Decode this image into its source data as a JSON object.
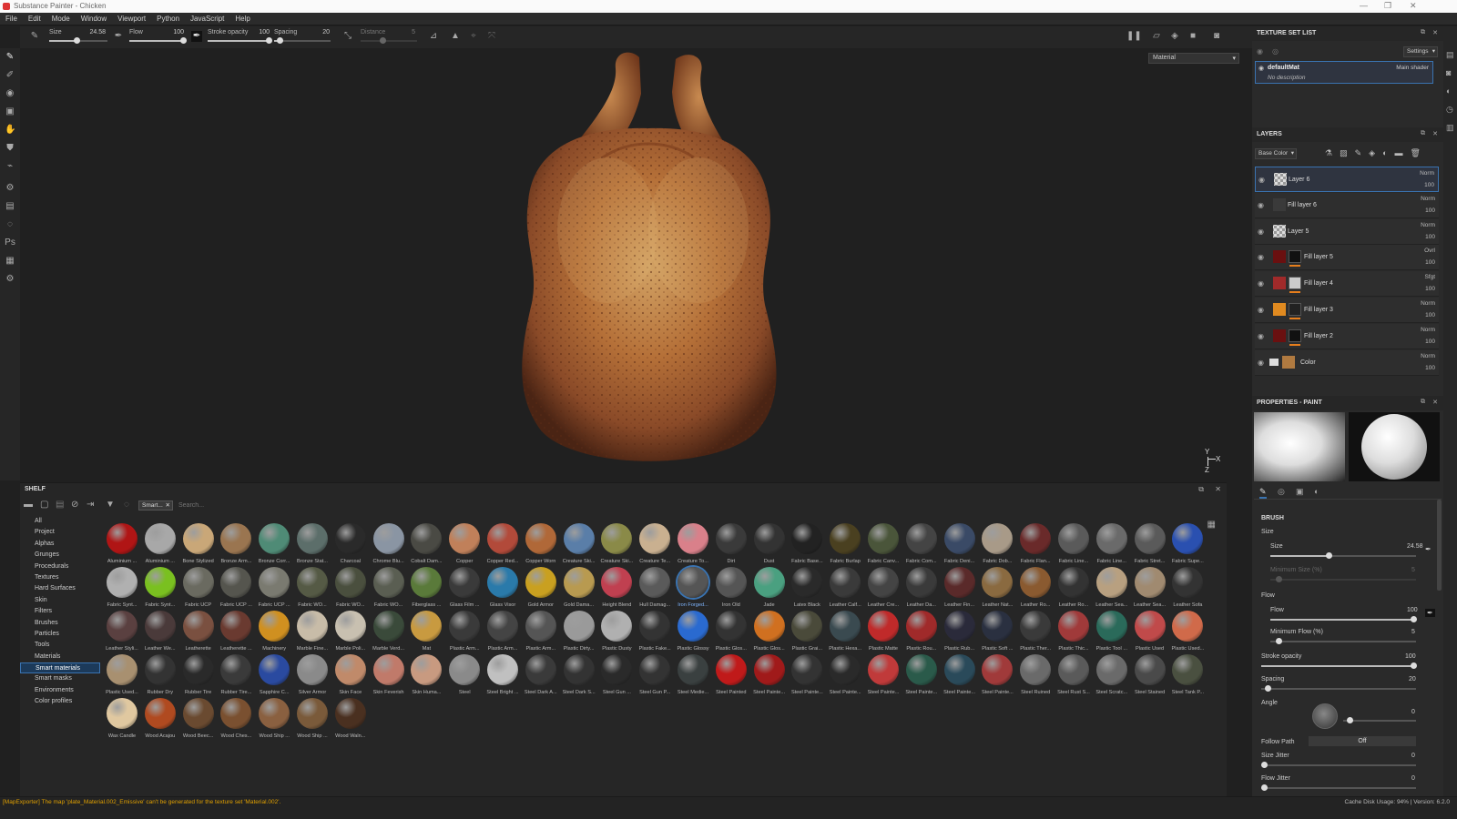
{
  "window": {
    "title": "Substance Painter - Chicken"
  },
  "menu": [
    "File",
    "Edit",
    "Mode",
    "Window",
    "Viewport",
    "Python",
    "JavaScript",
    "Help"
  ],
  "toolbar": {
    "size_label": "Size",
    "size_value": "24.58",
    "flow_label": "Flow",
    "flow_value": "100",
    "stroke_opacity_label": "Stroke opacity",
    "stroke_opacity_value": "100",
    "spacing_label": "Spacing",
    "spacing_value": "20",
    "distance_label": "Distance",
    "distance_value": "5"
  },
  "viewport": {
    "mode_select": "Material",
    "axis_y": "Y",
    "axis_z": "Z",
    "axis_x": "X"
  },
  "shelf": {
    "title": "SHELF",
    "filter_chip": "Smart...",
    "search_placeholder": "Search...",
    "categories": [
      "All",
      "Project",
      "Alphas",
      "Grunges",
      "Procedurals",
      "Textures",
      "Hard Surfaces",
      "Skin",
      "Filters",
      "Brushes",
      "Particles",
      "Tools",
      "Materials",
      "Smart materials",
      "Smart masks",
      "Environments",
      "Color profiles"
    ],
    "selected_category": "Smart materials",
    "materials": [
      {
        "n": "Aluminium ...",
        "c": "#b01515"
      },
      {
        "n": "Aluminium ...",
        "c": "#a8a8a8"
      },
      {
        "n": "Bone Stylized",
        "c": "#c9a778"
      },
      {
        "n": "Bronze Arm...",
        "c": "#9a7550"
      },
      {
        "n": "Bronze Corr...",
        "c": "#4f8b76"
      },
      {
        "n": "Bronze Stat...",
        "c": "#5c6e6a"
      },
      {
        "n": "Charcoal",
        "c": "#2a2a2a"
      },
      {
        "n": "Chrome Blu...",
        "c": "#8a95a3"
      },
      {
        "n": "Cobalt Dam...",
        "c": "#4a4a44"
      },
      {
        "n": "Copper",
        "c": "#c0805a"
      },
      {
        "n": "Copper Red...",
        "c": "#b24a3a"
      },
      {
        "n": "Copper Worn",
        "c": "#b06838"
      },
      {
        "n": "Creature Ski...",
        "c": "#5a7ea8"
      },
      {
        "n": "Creature Ski...",
        "c": "#8a8a48"
      },
      {
        "n": "Creature Te...",
        "c": "#c9b090"
      },
      {
        "n": "Creature To...",
        "c": "#d9808a"
      },
      {
        "n": "Dirt",
        "c": "#3a3a3a"
      },
      {
        "n": "Dust",
        "c": "#333"
      },
      {
        "n": "Fabric Base...",
        "c": "#222"
      },
      {
        "n": "Fabric Burlap",
        "c": "#4a4020"
      },
      {
        "n": "Fabric Canv...",
        "c": "#4a553a"
      },
      {
        "n": "Fabric Com...",
        "c": "#444"
      },
      {
        "n": "Fabric Deni...",
        "c": "#3a4a66"
      },
      {
        "n": "Fabric Dob...",
        "c": "#a89a88"
      },
      {
        "n": "Fabric Flan...",
        "c": "#6a2a2a"
      },
      {
        "n": "Fabric Line...",
        "c": "#5a5a5a"
      },
      {
        "n": "Fabric Line...",
        "c": "#6a6a6a"
      },
      {
        "n": "Fabric Stret...",
        "c": "#5a5a5a"
      },
      {
        "n": "Fabric Supe...",
        "c": "#2a50b0"
      },
      {
        "n": "Fabric Synt...",
        "c": "#b0b0b0"
      },
      {
        "n": "Fabric Synt...",
        "c": "#7ac020"
      },
      {
        "n": "Fabric UCP",
        "c": "#6a6a60"
      },
      {
        "n": "Fabric UCP ...",
        "c": "#55554e"
      },
      {
        "n": "Fabric UCP ...",
        "c": "#7a7a70"
      },
      {
        "n": "Fabric WO...",
        "c": "#555a45"
      },
      {
        "n": "Fabric WO...",
        "c": "#4a4f3e"
      },
      {
        "n": "Fabric WO...",
        "c": "#5a5e52"
      },
      {
        "n": "Fiberglass ...",
        "c": "#5a7a3a"
      },
      {
        "n": "Glass Film ...",
        "c": "#3a3a3a"
      },
      {
        "n": "Glass Visor",
        "c": "#2a7aaa"
      },
      {
        "n": "Gold Armor",
        "c": "#c9a020"
      },
      {
        "n": "Gold Dama...",
        "c": "#b89a50"
      },
      {
        "n": "Height Blend",
        "c": "#c04050"
      },
      {
        "n": "Hull Damag...",
        "c": "#5a5a5a"
      },
      {
        "n": "Iron Forged...",
        "c": "#555"
      },
      {
        "n": "Iron Old",
        "c": "#555"
      },
      {
        "n": "Jade",
        "c": "#4aa080"
      },
      {
        "n": "Latex Black",
        "c": "#2a2a2a"
      },
      {
        "n": "Leather Calf...",
        "c": "#3a3a3a"
      },
      {
        "n": "Leather Cre...",
        "c": "#444"
      },
      {
        "n": "Leather Da...",
        "c": "#3a3a3a"
      },
      {
        "n": "Leather Fin...",
        "c": "#5a2a2a"
      },
      {
        "n": "Leather Nat...",
        "c": "#8a6a40"
      },
      {
        "n": "Leather Ro...",
        "c": "#8a5a30"
      },
      {
        "n": "Leather Ro...",
        "c": "#333"
      },
      {
        "n": "Leather Sea...",
        "c": "#b8a080"
      },
      {
        "n": "Leather Sea...",
        "c": "#a08a70"
      },
      {
        "n": "Leather Sofa",
        "c": "#333"
      },
      {
        "n": "Leather Styli...",
        "c": "#5a4040"
      },
      {
        "n": "Leather We...",
        "c": "#4a3a3a"
      },
      {
        "n": "Leatherette",
        "c": "#7a5040"
      },
      {
        "n": "Leatherette ...",
        "c": "#6a3a30"
      },
      {
        "n": "Machinery",
        "c": "#d09020"
      },
      {
        "n": "Marble Fine...",
        "c": "#c8bca8"
      },
      {
        "n": "Marble Poli...",
        "c": "#c8c0b0"
      },
      {
        "n": "Marble Verd...",
        "c": "#3a4a3a"
      },
      {
        "n": "Mat",
        "c": "#c89a40"
      },
      {
        "n": "Plastic Arm...",
        "c": "#3a3a3a"
      },
      {
        "n": "Plastic Arm...",
        "c": "#444"
      },
      {
        "n": "Plastic Arm...",
        "c": "#555"
      },
      {
        "n": "Plastic Dirty...",
        "c": "#9a9a9a"
      },
      {
        "n": "Plastic Dusty",
        "c": "#b0b0b0"
      },
      {
        "n": "Plastic Fake...",
        "c": "#333"
      },
      {
        "n": "Plastic Glossy",
        "c": "#2a6ad0"
      },
      {
        "n": "Plastic Glos...",
        "c": "#333"
      },
      {
        "n": "Plastic Glos...",
        "c": "#d07020"
      },
      {
        "n": "Plastic Grai...",
        "c": "#4a4a3a"
      },
      {
        "n": "Plastic Hexa...",
        "c": "#3a4a50"
      },
      {
        "n": "Plastic Matte",
        "c": "#c02a2a"
      },
      {
        "n": "Plastic Rou...",
        "c": "#a02a2a"
      },
      {
        "n": "Plastic Rub...",
        "c": "#2a2a3a"
      },
      {
        "n": "Plastic Soft ...",
        "c": "#2a3040"
      },
      {
        "n": "Plastic Ther...",
        "c": "#3a3a3a"
      },
      {
        "n": "Plastic Thic...",
        "c": "#a03a3a"
      },
      {
        "n": "Plastic Tool ...",
        "c": "#2a6a5a"
      },
      {
        "n": "Plastic Used",
        "c": "#c04a4a"
      },
      {
        "n": "Plastic Used...",
        "c": "#d06a4a"
      },
      {
        "n": "Plastic Used...",
        "c": "#a89070"
      },
      {
        "n": "Rubber Dry",
        "c": "#333"
      },
      {
        "n": "Rubber Tire",
        "c": "#2a2a2a"
      },
      {
        "n": "Rubber Tire...",
        "c": "#3a3a3a"
      },
      {
        "n": "Sapphire C...",
        "c": "#2a4aa0"
      },
      {
        "n": "Silver Armor",
        "c": "#8a8a8a"
      },
      {
        "n": "Skin Face",
        "c": "#c08a6a"
      },
      {
        "n": "Skin Feverish",
        "c": "#c07a6a"
      },
      {
        "n": "Skin Huma...",
        "c": "#c89a80"
      },
      {
        "n": "Steel",
        "c": "#8a8a8a"
      },
      {
        "n": "Steel Bright ...",
        "c": "#c0c0c0"
      },
      {
        "n": "Steel Dark A...",
        "c": "#3a3a3a"
      },
      {
        "n": "Steel Dark S...",
        "c": "#333"
      },
      {
        "n": "Steel Gun ...",
        "c": "#2a2a2a"
      },
      {
        "n": "Steel Gun P...",
        "c": "#333"
      },
      {
        "n": "Steel Medie...",
        "c": "#3a4040"
      },
      {
        "n": "Steel Painted",
        "c": "#c01a1a"
      },
      {
        "n": "Steel Painte...",
        "c": "#a01a1a"
      },
      {
        "n": "Steel Painte...",
        "c": "#333"
      },
      {
        "n": "Steel Painte...",
        "c": "#2a2a2a"
      },
      {
        "n": "Steel Painte...",
        "c": "#c03a3a"
      },
      {
        "n": "Steel Painte...",
        "c": "#2a5a4a"
      },
      {
        "n": "Steel Painte...",
        "c": "#2a4a5a"
      },
      {
        "n": "Steel Painte...",
        "c": "#a03a3a"
      },
      {
        "n": "Steel Ruined",
        "c": "#6a6a6a"
      },
      {
        "n": "Steel Rust S...",
        "c": "#5a5a5a"
      },
      {
        "n": "Steel Scratc...",
        "c": "#6a6a6a"
      },
      {
        "n": "Steel Stained",
        "c": "#4a4a4a"
      },
      {
        "n": "Steel Tank P...",
        "c": "#4a5040"
      },
      {
        "n": "Wax Candle",
        "c": "#e0c8a0"
      },
      {
        "n": "Wood Acajou",
        "c": "#b04a20"
      },
      {
        "n": "Wood Beec...",
        "c": "#6a4a30"
      },
      {
        "n": "Wood Ches...",
        "c": "#7a5030"
      },
      {
        "n": "Wood Ship ...",
        "c": "#8a6040"
      },
      {
        "n": "Wood Ship ...",
        "c": "#7a5a3a"
      },
      {
        "n": "Wood Waln...",
        "c": "#4a3020"
      }
    ],
    "selected_material_index": 44
  },
  "texture_set_list": {
    "title": "TEXTURE SET LIST",
    "settings_label": "Settings",
    "item_name": "defaultMat",
    "item_shader": "Main shader",
    "item_desc": "No description"
  },
  "layers": {
    "title": "LAYERS",
    "channel": "Base Color",
    "items": [
      {
        "name": "Layer 6",
        "blend": "Norm",
        "opacity": "100",
        "thumb": "#cfcfcf",
        "mask": "",
        "kind": "paint",
        "visible": true,
        "selected": true
      },
      {
        "name": "Fill layer 6",
        "blend": "Norm",
        "opacity": "100",
        "thumb": "#3a3a3a",
        "mask": "",
        "kind": "fill",
        "visible": true,
        "selected": false
      },
      {
        "name": "Layer 5",
        "blend": "Norm",
        "opacity": "100",
        "thumb": "#cfcfcf",
        "mask": "",
        "kind": "paint",
        "visible": true,
        "selected": false
      },
      {
        "name": "Fill layer 5",
        "blend": "Ovrl",
        "opacity": "100",
        "thumb": "#6a1010",
        "mask": "#111",
        "kind": "fill",
        "visible": true,
        "selected": false
      },
      {
        "name": "Fill layer 4",
        "blend": "Sfgt",
        "opacity": "100",
        "thumb": "#a02a2a",
        "mask": "#ccc",
        "kind": "fill",
        "visible": true,
        "selected": false
      },
      {
        "name": "Fill layer 3",
        "blend": "Norm",
        "opacity": "100",
        "thumb": "#e08a20",
        "mask": "#222",
        "kind": "fill",
        "visible": true,
        "selected": false
      },
      {
        "name": "Fill layer 2",
        "blend": "Norm",
        "opacity": "100",
        "thumb": "#6a1010",
        "mask": "#111",
        "kind": "fill",
        "visible": true,
        "selected": false
      },
      {
        "name": "Color",
        "blend": "Norm",
        "opacity": "100",
        "thumb": "#b07a40",
        "mask": "",
        "kind": "folder",
        "visible": true,
        "selected": false
      }
    ]
  },
  "properties": {
    "title": "PROPERTIES - PAINT",
    "brush_section": "BRUSH",
    "size_section": "Size",
    "size_label": "Size",
    "size_value": "24.58",
    "min_size_label": "Minimum Size (%)",
    "min_size_value": "5",
    "flow_section": "Flow",
    "flow_label": "Flow",
    "flow_value": "100",
    "min_flow_label": "Minimum Flow (%)",
    "min_flow_value": "5",
    "stroke_opacity_label": "Stroke opacity",
    "stroke_opacity_value": "100",
    "spacing_label": "Spacing",
    "spacing_value": "20",
    "angle_label": "Angle",
    "angle_value": "0",
    "follow_path_label": "Follow Path",
    "follow_path_value": "Off",
    "size_jitter_label": "Size Jitter",
    "size_jitter_value": "0",
    "flow_jitter_label": "Flow Jitter",
    "flow_jitter_value": "0"
  },
  "status": {
    "error": "[MapExporter] The map 'plate_Material.002_Emissive' can't be generated for the texture set 'Material.002'.",
    "info": "Cache Disk Usage:   94%  |  Version: 6.2.0"
  }
}
